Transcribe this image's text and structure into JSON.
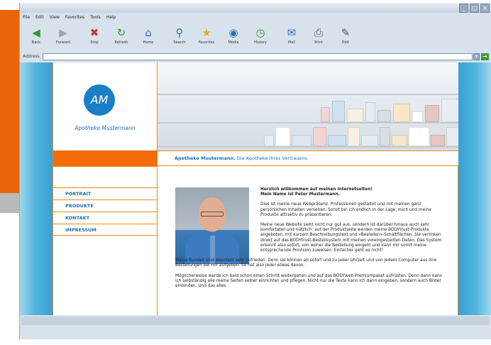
{
  "browser": {
    "menu": [
      "File",
      "Edit",
      "View",
      "Favorites",
      "Tools",
      "Help"
    ],
    "toolbar": [
      {
        "label": "Back",
        "icon": "back-arrow-icon",
        "glyph": "◀",
        "color": "#2f9a2f"
      },
      {
        "label": "Forward",
        "icon": "forward-arrow-icon",
        "glyph": "▶",
        "color": "#9aa5b0"
      },
      {
        "label": "Stop",
        "icon": "stop-icon",
        "glyph": "✖",
        "color": "#c0392b"
      },
      {
        "label": "Refresh",
        "icon": "refresh-icon",
        "glyph": "↻",
        "color": "#2f9a2f"
      },
      {
        "label": "Home",
        "icon": "home-icon",
        "glyph": "⌂",
        "color": "#2f6fb0"
      },
      {
        "label": "Search",
        "icon": "search-icon",
        "glyph": "⚲",
        "color": "#2f6fb0"
      },
      {
        "label": "Favorites",
        "icon": "star-icon",
        "glyph": "★",
        "color": "#e0b000"
      },
      {
        "label": "Media",
        "icon": "media-icon",
        "glyph": "◉",
        "color": "#2f6fb0"
      },
      {
        "label": "History",
        "icon": "history-icon",
        "glyph": "◷",
        "color": "#2f9a2f"
      },
      {
        "label": "Mail",
        "icon": "mail-icon",
        "glyph": "✉",
        "color": "#2f6fb0"
      },
      {
        "label": "Print",
        "icon": "print-icon",
        "glyph": "⎙",
        "color": "#555555"
      },
      {
        "label": "Edit",
        "icon": "edit-icon",
        "glyph": "✎",
        "color": "#555555"
      }
    ],
    "address_label": "Address",
    "address_value": ""
  },
  "site": {
    "logo_initials": "AM",
    "logo_name": "Apotheke Mustermann",
    "tagline_bold": "Apotheke Mustermann.",
    "tagline_rest": "Die Apotheke Ihres Vertrauens.",
    "nav": [
      "PORTRAIT",
      "PRODUKTE",
      "KONTAKT",
      "IMPRESSUM"
    ],
    "headline_1": "Herzlich willkommen auf meinen Internetseiten!",
    "headline_2": "Mein Name ist Peter Mustermann.",
    "paragraphs": [
      "Dies ist meine neue Webpräsenz. Professionell gestaltet und mit meinen ganz persönlichen Inhalten versehen. Somit bin ich endlich in der Lage, mich und meine Produkte attraktiv zu präsentieren.",
      "Meine neue Website sieht nicht nur gut aus, sondern ist darüber hinaus auch sehr komfortabel und nützlich: auf der Produktseite werden meine BODYtrust-Produkte angeboten, mit kurzem Beschreibungstext und »Bestellen«-Schaltflächen. Sie verlinken direkt auf das BODYtrust-Bestellsystem mit meinen voreingestellten Daten. Das System erkennt also sofort, von woher die Bestellung eingeht und kann mir somit meine entsprechende Provision zuweisen. Einfacher geht es nicht!",
      "Meine Kunden sind ebenfalls sehr zufrieden. Denn sie können ab sofort und zu jeder Uhrzeit und von jedem Computer aus ihre Bestellungen bei mir aufgeben. So hat also jeder etwas davon.",
      "Möglicherweise werde ich bald schon einen Schritt weitergehen und auf das BODYweb-Premiumpaket aufrüsten. Denn dann kann ich selbständig alle meine Seiten selber einrichten und pflegen. Nicht nur die Texte kann ich dann eingeben, sondern auch Bilder einbinden. Und das alles"
    ]
  },
  "colors": {
    "accent_orange": "#f36b0b",
    "brand_blue": "#1a7fc5",
    "sky_blue": "#3aa0d2"
  }
}
